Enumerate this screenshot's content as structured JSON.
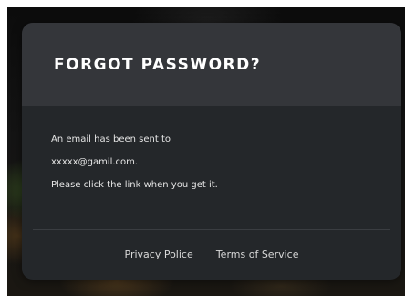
{
  "modal": {
    "title": "FORGOT PASSWORD?",
    "message_lines": [
      "An email has been sent to",
      "xxxxx@gamil.com.",
      "Please click the link when you get it."
    ],
    "footer_links": [
      "Privacy Police",
      "Terms of Service"
    ]
  },
  "colors": {
    "modal_header_bg": "#34363a",
    "modal_body_bg": "#24272a",
    "text": "#ffffff"
  }
}
